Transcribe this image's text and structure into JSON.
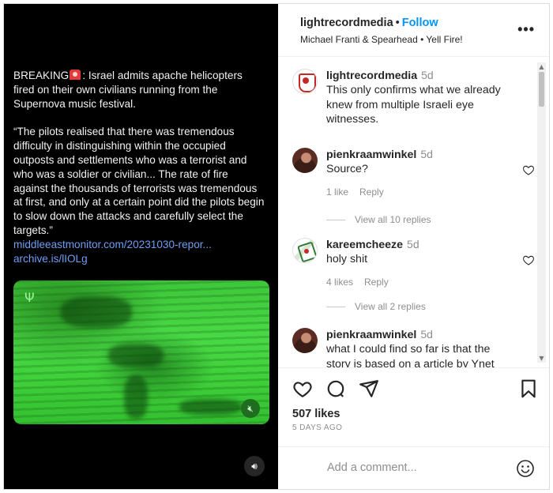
{
  "post": {
    "text": {
      "breaking": "BREAKING",
      "headline": ": Israel admits apache helicopters fired on their own civilians running from the Supernova music festival.",
      "quote": "“The pilots realised that there was tremendous difficulty in distinguishing within the occupied outposts and settlements who was a terrorist and who was a soldier or civilian... The rate of fire against the thousands of terrorists was tremendous at first, and only at a certain point did the pilots begin to slow down the attacks and carefully select the targets.”",
      "link1": "middleeastmonitor.com/20231030-repor...",
      "link2": "archive.is/lIOLg"
    },
    "video_icons": {
      "corner": "antenna-icon",
      "mute": "muted-speaker-icon",
      "sound": "speaker-icon"
    }
  },
  "header": {
    "username": "lightrecordmedia",
    "separator": "•",
    "follow_label": "Follow",
    "music": "Michael Franti & Spearhead • Yell Fire!",
    "more": "•••"
  },
  "comments": [
    {
      "username": "lightrecordmedia",
      "time": "5d",
      "text": "This only confirms what we already knew from multiple Israeli eye witnesses."
    },
    {
      "username": "pienkraamwinkel",
      "time": "5d",
      "text": "Source?",
      "likes": "1 like",
      "reply": "Reply",
      "view_replies": "View all 10 replies"
    },
    {
      "username": "kareemcheeze",
      "time": "5d",
      "text": "holy shit",
      "likes": "4 likes",
      "reply": "Reply",
      "view_replies": "View all 2 replies"
    },
    {
      "username": "pienkraamwinkel",
      "time": "5d",
      "text": "what I could find so far is that the story is based on a article by Ynet"
    }
  ],
  "actions": {
    "likes": "507 likes",
    "date": "5 DAYS AGO"
  },
  "add_comment": {
    "placeholder": "Add a comment..."
  },
  "colors": {
    "accent": "#0095f6",
    "link": "#6f9ef3",
    "video_green": "#45d542"
  }
}
